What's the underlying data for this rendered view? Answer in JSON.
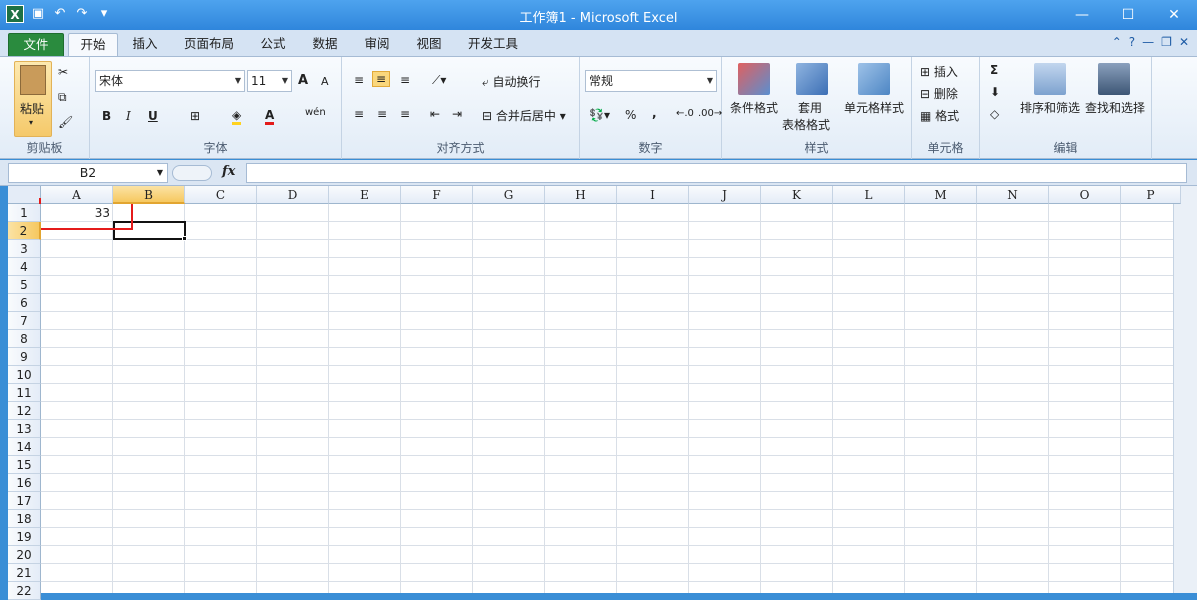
{
  "window": {
    "title": "工作簿1 - Microsoft Excel"
  },
  "qat": {
    "logo": "X"
  },
  "tabs": {
    "file": "文件",
    "home": "开始",
    "insert": "插入",
    "layout": "页面布局",
    "formulas": "公式",
    "data": "数据",
    "review": "审阅",
    "view": "视图",
    "developer": "开发工具"
  },
  "ribbon": {
    "clipboard": {
      "label": "剪贴板",
      "paste": "粘贴"
    },
    "font": {
      "label": "字体",
      "name": "宋体",
      "size": "11",
      "bold": "B",
      "italic": "I",
      "underline": "U",
      "grow": "A",
      "shrink": "A",
      "fontcolor": "A",
      "phonetic": "wén"
    },
    "alignment": {
      "label": "对齐方式",
      "wrap": "自动换行",
      "merge": "合并后居中"
    },
    "number": {
      "label": "数字",
      "format": "常规",
      "percent": "%",
      "comma": ","
    },
    "styles": {
      "label": "样式",
      "conditional": "条件格式",
      "table1": "套用",
      "table2": "表格格式",
      "cellstyle": "单元格样式"
    },
    "cells": {
      "label": "单元格",
      "insert": "插入",
      "delete": "删除",
      "format": "格式"
    },
    "editing": {
      "label": "编辑",
      "sum": "Σ",
      "sort": "排序和筛选",
      "find": "查找和选择"
    }
  },
  "formula_bar": {
    "name_box": "B2",
    "fx": "fx",
    "value": ""
  },
  "sheet": {
    "columns": [
      "A",
      "B",
      "C",
      "D",
      "E",
      "F",
      "G",
      "H",
      "I",
      "J",
      "K",
      "L",
      "M",
      "N",
      "O",
      "P"
    ],
    "rows": [
      "1",
      "2",
      "3",
      "4",
      "5",
      "6",
      "7",
      "8",
      "9",
      "10",
      "11",
      "12",
      "13",
      "14",
      "15",
      "16",
      "17",
      "18",
      "19",
      "20",
      "21",
      "22"
    ],
    "selected_column": "B",
    "selected_row": "2",
    "cells": {
      "A1": "33"
    }
  },
  "colors": {
    "accent": "#2f86dc",
    "file_tab": "#2a8b3e",
    "highlight": "#e41b1b"
  }
}
